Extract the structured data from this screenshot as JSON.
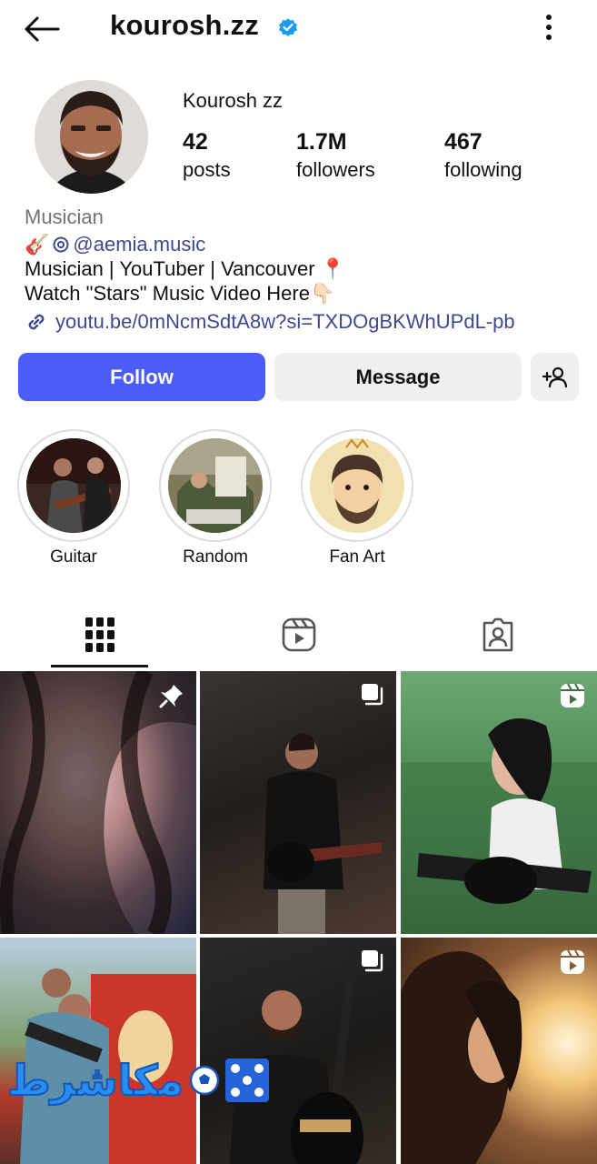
{
  "header": {
    "username": "kourosh.zz",
    "verified": true,
    "back_icon": "arrow-left-icon",
    "more_icon": "more-vertical-icon"
  },
  "profile": {
    "display_name": "Kourosh zz",
    "stats": [
      {
        "value": "42",
        "label": "posts"
      },
      {
        "value": "1.7M",
        "label": "followers"
      },
      {
        "value": "467",
        "label": "following"
      }
    ],
    "category": "Musician",
    "threads_handle": "@aemia.music",
    "bio_line_1": "Musician | YouTuber | Vancouver 📍",
    "bio_line_2": "Watch \"Stars\" Music Video Here👇🏻",
    "link": "youtu.be/0mNcmSdtA8w?si=TXDOgBKWhUPdL-pb"
  },
  "actions": {
    "follow_label": "Follow",
    "message_label": "Message",
    "add_user_icon": "add-user-icon"
  },
  "highlights": [
    {
      "label": "Guitar"
    },
    {
      "label": "Random"
    },
    {
      "label": "Fan Art"
    }
  ],
  "tabs": [
    {
      "icon": "grid-icon",
      "active": true
    },
    {
      "icon": "reels-icon",
      "active": false
    },
    {
      "icon": "tagged-icon",
      "active": false
    }
  ],
  "posts": [
    {
      "badge": "pin-icon"
    },
    {
      "badge": "carousel-icon"
    },
    {
      "badge": "reel-icon"
    },
    {
      "badge": "none"
    },
    {
      "badge": "carousel-icon"
    },
    {
      "badge": "reel-icon"
    }
  ],
  "watermark_text": "مكاشرط",
  "colors": {
    "follow_button": "#4a5df9",
    "secondary_button": "#efeff2",
    "link": "#3c4a8f",
    "verified": "#1d9bf0"
  }
}
